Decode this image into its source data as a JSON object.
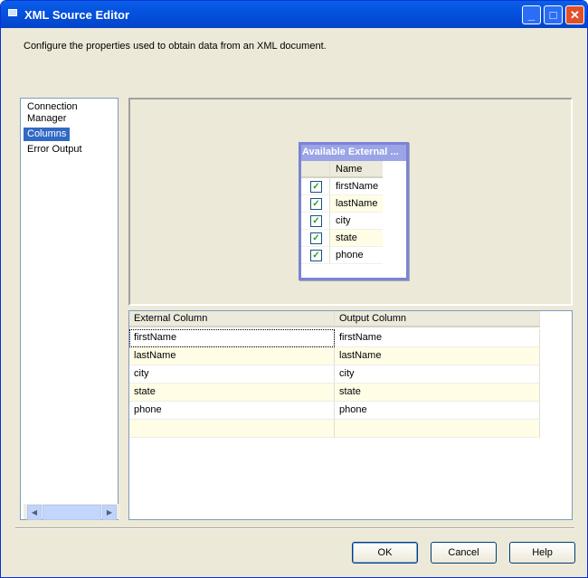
{
  "window": {
    "title": "XML Source Editor",
    "description": "Configure the properties used to obtain data from an XML document."
  },
  "nav": {
    "items": [
      "Connection Manager",
      "Columns",
      "Error Output"
    ],
    "selected": "Columns"
  },
  "available": {
    "title": "Available External ...",
    "header": "Name",
    "columns": [
      {
        "name": "firstName",
        "checked": true
      },
      {
        "name": "lastName",
        "checked": true
      },
      {
        "name": "city",
        "checked": true
      },
      {
        "name": "state",
        "checked": true
      },
      {
        "name": "phone",
        "checked": true
      }
    ]
  },
  "mapping": {
    "headers": [
      "External Column",
      "Output Column"
    ],
    "rows": [
      [
        "firstName",
        "firstName"
      ],
      [
        "lastName",
        "lastName"
      ],
      [
        "city",
        "city"
      ],
      [
        "state",
        "state"
      ],
      [
        "phone",
        "phone"
      ],
      [
        "",
        ""
      ]
    ]
  },
  "buttons": {
    "ok": "OK",
    "cancel": "Cancel",
    "help": "Help"
  }
}
